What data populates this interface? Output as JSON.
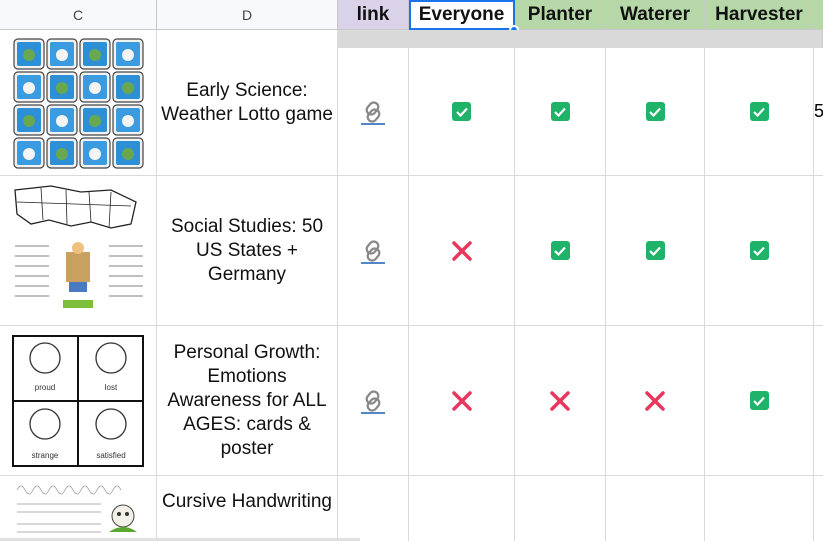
{
  "columns": {
    "c": "C",
    "d": "D"
  },
  "headers": {
    "link": "link",
    "everyone": "Everyone",
    "planter": "Planter",
    "waterer": "Waterer",
    "harvester": "Harvester"
  },
  "colors": {
    "link_header_bg": "#d9d2e9",
    "everyone_header_bg": "#ffffff",
    "green_header_bg": "#b6d7a8",
    "check_green": "#1fb36a",
    "x_red": "#e8365d",
    "selection_blue": "#1a73e8"
  },
  "rows": [
    {
      "description": "Early Science: Weather Lotto game",
      "thumbnail": "weather-lotto-cards-image",
      "everyone": "checked",
      "planter": "checked",
      "waterer": "checked",
      "harvester": "checked",
      "overflow": "5"
    },
    {
      "description": "Social Studies: 50 US States + Germany",
      "thumbnail": "us-map-worksheet-image",
      "everyone": "x",
      "planter": "checked",
      "waterer": "checked",
      "harvester": "checked"
    },
    {
      "description": "Personal Growth: Emotions Awareness for ALL AGES: cards & poster",
      "thumbnail": "emotion-faces-cards-image",
      "everyone": "x",
      "planter": "x",
      "waterer": "x",
      "harvester": "checked",
      "faces": [
        "proud",
        "lost",
        "strange",
        "satisfied"
      ]
    },
    {
      "description": "Cursive Handwriting",
      "thumbnail": "cursive-worksheet-image",
      "everyone": "",
      "planter": "",
      "waterer": "",
      "harvester": ""
    }
  ]
}
